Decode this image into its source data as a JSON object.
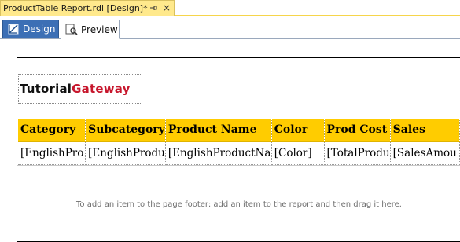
{
  "document_tab": {
    "title": "ProductTable Report.rdl [Design]*"
  },
  "view_tabs": {
    "design": "Design",
    "preview": "Preview"
  },
  "logo": {
    "part1": "Tutorial",
    "part2": "Gateway",
    "colors": {
      "part1": "#111111",
      "part2": "#c7172d"
    }
  },
  "table": {
    "headers": [
      "Category",
      "Subcategory",
      "Product Name",
      "Color",
      "Prod Cost",
      "Sales"
    ],
    "cells": [
      "[EnglishPro",
      "[EnglishProdu",
      "[EnglishProductNa",
      "[Color]",
      "[TotalProdu",
      "[SalesAmou"
    ],
    "header_color": "#ffcc00"
  },
  "footer": {
    "hint": "To add an item to the page footer: add an item to the report and then drag it here."
  },
  "icons": {
    "pin": "pin-icon",
    "close": "close-icon",
    "design": "design-ruler-icon",
    "preview": "preview-magnifier-icon"
  }
}
